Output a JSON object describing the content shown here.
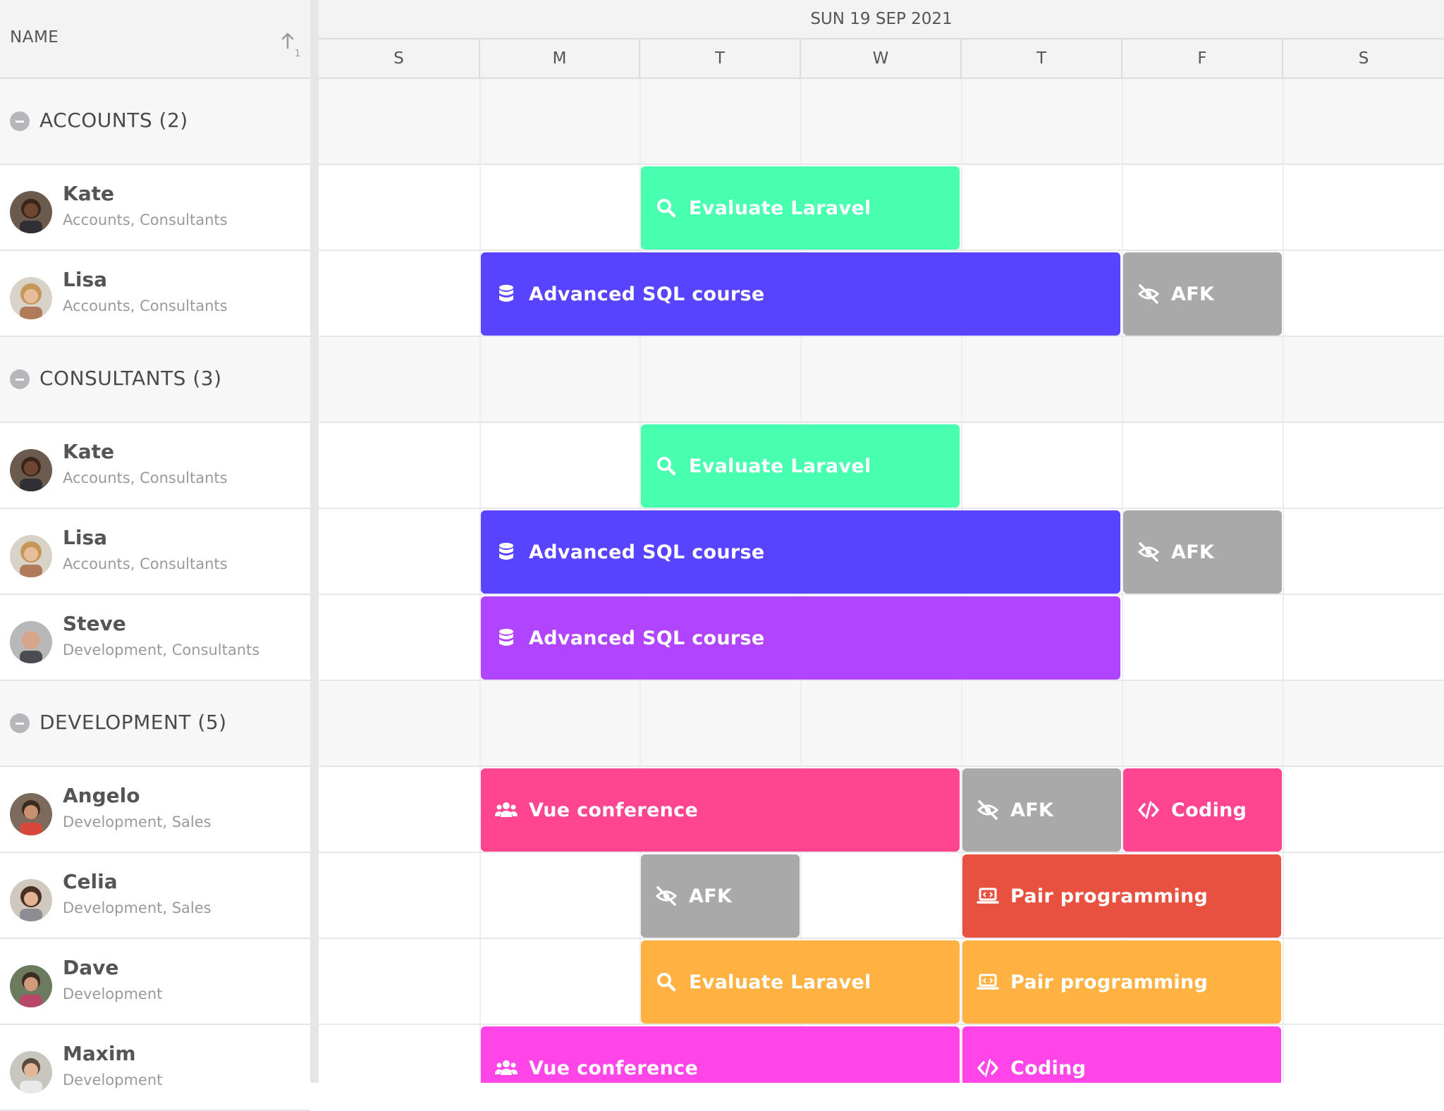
{
  "header": {
    "name_column": "NAME",
    "sort_index": "1",
    "date": "SUN 19 SEP 2021",
    "days": [
      "S",
      "M",
      "T",
      "W",
      "T",
      "F",
      "S"
    ]
  },
  "groups": [
    {
      "title": "ACCOUNTS (2)"
    },
    {
      "title": "CONSULTANTS (3)"
    },
    {
      "title": "DEVELOPMENT (5)"
    }
  ],
  "resources": [
    {
      "name": "Kate",
      "sub": "Accounts, Consultants"
    },
    {
      "name": "Lisa",
      "sub": "Accounts, Consultants"
    },
    {
      "name": "Kate",
      "sub": "Accounts, Consultants"
    },
    {
      "name": "Lisa",
      "sub": "Accounts, Consultants"
    },
    {
      "name": "Steve",
      "sub": "Development, Consultants"
    },
    {
      "name": "Angelo",
      "sub": "Development, Sales"
    },
    {
      "name": "Celia",
      "sub": "Development, Sales"
    },
    {
      "name": "Dave",
      "sub": "Development"
    },
    {
      "name": "Maxim",
      "sub": "Development"
    }
  ],
  "events": [
    {
      "label": "Evaluate Laravel",
      "icon": "search-icon",
      "color": "#48ffb0"
    },
    {
      "label": "Advanced SQL course",
      "icon": "database-icon",
      "color": "#5844ff"
    },
    {
      "label": "AFK",
      "icon": "eye-slash-icon",
      "color": "#a9a9a9"
    },
    {
      "label": "Evaluate Laravel",
      "icon": "search-icon",
      "color": "#48ffb0"
    },
    {
      "label": "Advanced SQL course",
      "icon": "database-icon",
      "color": "#5844ff"
    },
    {
      "label": "AFK",
      "icon": "eye-slash-icon",
      "color": "#a9a9a9"
    },
    {
      "label": "Advanced SQL course",
      "icon": "database-icon",
      "color": "#b044ff"
    },
    {
      "label": "Vue conference",
      "icon": "users-icon",
      "color": "#ff4590"
    },
    {
      "label": "AFK",
      "icon": "eye-slash-icon",
      "color": "#a9a9a9"
    },
    {
      "label": "Coding",
      "icon": "code-icon",
      "color": "#ff4590"
    },
    {
      "label": "AFK",
      "icon": "eye-slash-icon",
      "color": "#a9a9a9"
    },
    {
      "label": "Pair programming",
      "icon": "laptop-code-icon",
      "color": "#e8503f"
    },
    {
      "label": "Evaluate Laravel",
      "icon": "search-icon",
      "color": "#ffb142"
    },
    {
      "label": "Pair programming",
      "icon": "laptop-code-icon",
      "color": "#ffb142"
    },
    {
      "label": "Vue conference",
      "icon": "users-icon",
      "color": "#ff44e8"
    },
    {
      "label": "Coding",
      "icon": "code-icon",
      "color": "#ff44e8"
    }
  ]
}
